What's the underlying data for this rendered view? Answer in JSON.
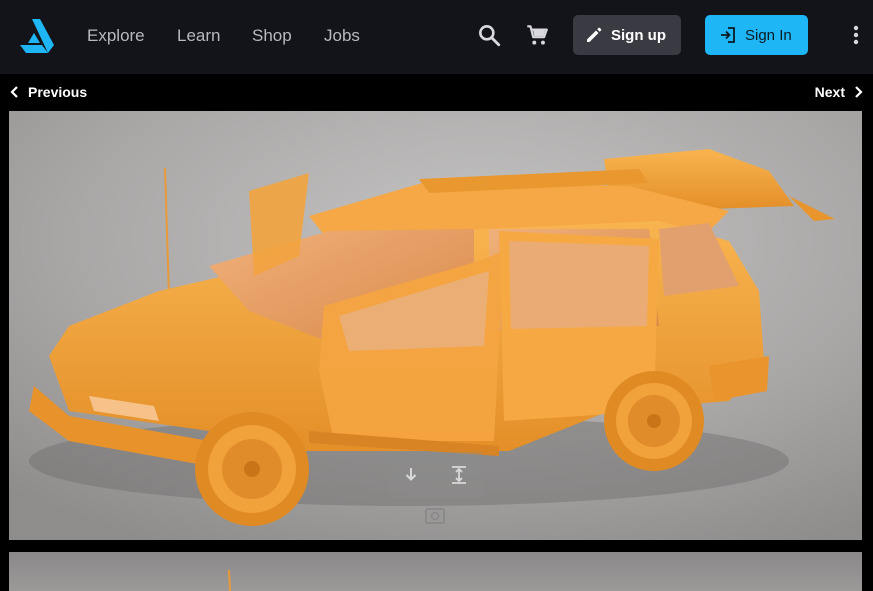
{
  "header": {
    "logo_name": "artstation-logo",
    "nav": [
      {
        "label": "Explore"
      },
      {
        "label": "Learn"
      },
      {
        "label": "Shop"
      },
      {
        "label": "Jobs"
      }
    ],
    "search_icon": "search-icon",
    "cart_icon": "cart-icon",
    "signup_label": "Sign up",
    "signin_label": "Sign In",
    "more_icon": "more-vertical-icon"
  },
  "pager": {
    "previous_label": "Previous",
    "next_label": "Next"
  },
  "artwork": {
    "overlay_icons": [
      "download-icon",
      "fit-height-icon",
      "zoom-icon"
    ]
  },
  "colors": {
    "topbar": "#13131a",
    "accent": "#1fb6f5",
    "signup_bg": "#3a3a42",
    "car_orange": "#f2a23a",
    "backdrop": "#a8a6a5"
  }
}
